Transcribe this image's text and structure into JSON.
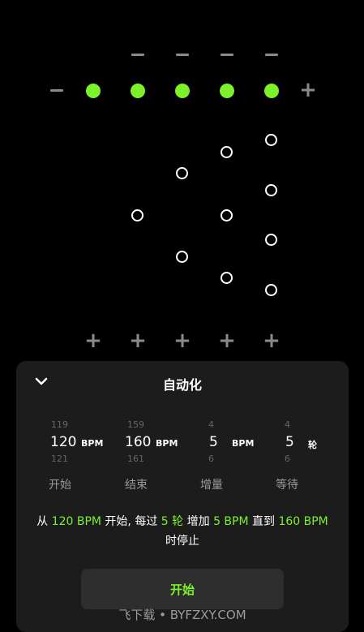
{
  "panel": {
    "title": "自动化",
    "pickers": [
      {
        "prev": "119",
        "current": "120",
        "next": "121",
        "unit": "BPM",
        "label": "开始"
      },
      {
        "prev": "159",
        "current": "160",
        "next": "161",
        "unit": "BPM",
        "label": "结束"
      },
      {
        "prev": "4",
        "current": "5",
        "next": "6",
        "unit": "BPM",
        "label": "增量"
      },
      {
        "prev": "4",
        "current": "5",
        "next": "6",
        "unit": "轮",
        "label": "等待"
      }
    ],
    "summary": {
      "p1": "从 ",
      "v1": "120 BPM",
      "p2": " 开始, 每过 ",
      "v2": "5 轮",
      "p3": " 增加 ",
      "v3": "5 BPM",
      "p4": " 直到 ",
      "v4": "160 BPM",
      "p5": " 时停止"
    },
    "start_label": "开始",
    "watermark": "飞下载 • BYFZXY.COM"
  },
  "beats": {
    "minus": "−",
    "plus": "+",
    "accent_color": "#7cf22a"
  }
}
